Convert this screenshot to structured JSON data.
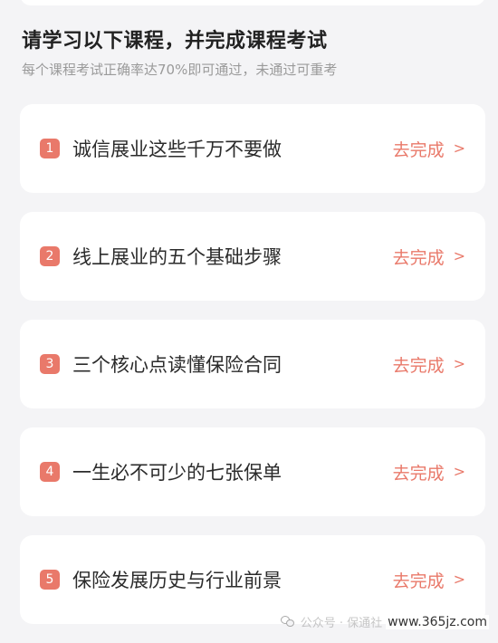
{
  "header": {
    "title": "请学习以下课程，并完成课程考试",
    "subtitle": "每个课程考试正确率达70%即可通过，未通过可重考"
  },
  "courses": [
    {
      "index": "1",
      "name": "诚信展业这些千万不要做",
      "action": "去完成",
      "chevron": ">"
    },
    {
      "index": "2",
      "name": "线上展业的五个基础步骤",
      "action": "去完成",
      "chevron": ">"
    },
    {
      "index": "3",
      "name": "三个核心点读懂保险合同",
      "action": "去完成",
      "chevron": ">"
    },
    {
      "index": "4",
      "name": "一生必不可少的七张保单",
      "action": "去完成",
      "chevron": ">"
    },
    {
      "index": "5",
      "name": "保险发展历史与行业前景",
      "action": "去完成",
      "chevron": ">"
    }
  ],
  "watermark": {
    "icon": "wechat-icon",
    "text": "公众号 · 保通社",
    "site": "www.365jz.com"
  },
  "colors": {
    "accent": "#e9796a",
    "background": "#f4f4f6",
    "card": "#ffffff",
    "title": "#222222",
    "subtitle": "#9a9a9a"
  }
}
